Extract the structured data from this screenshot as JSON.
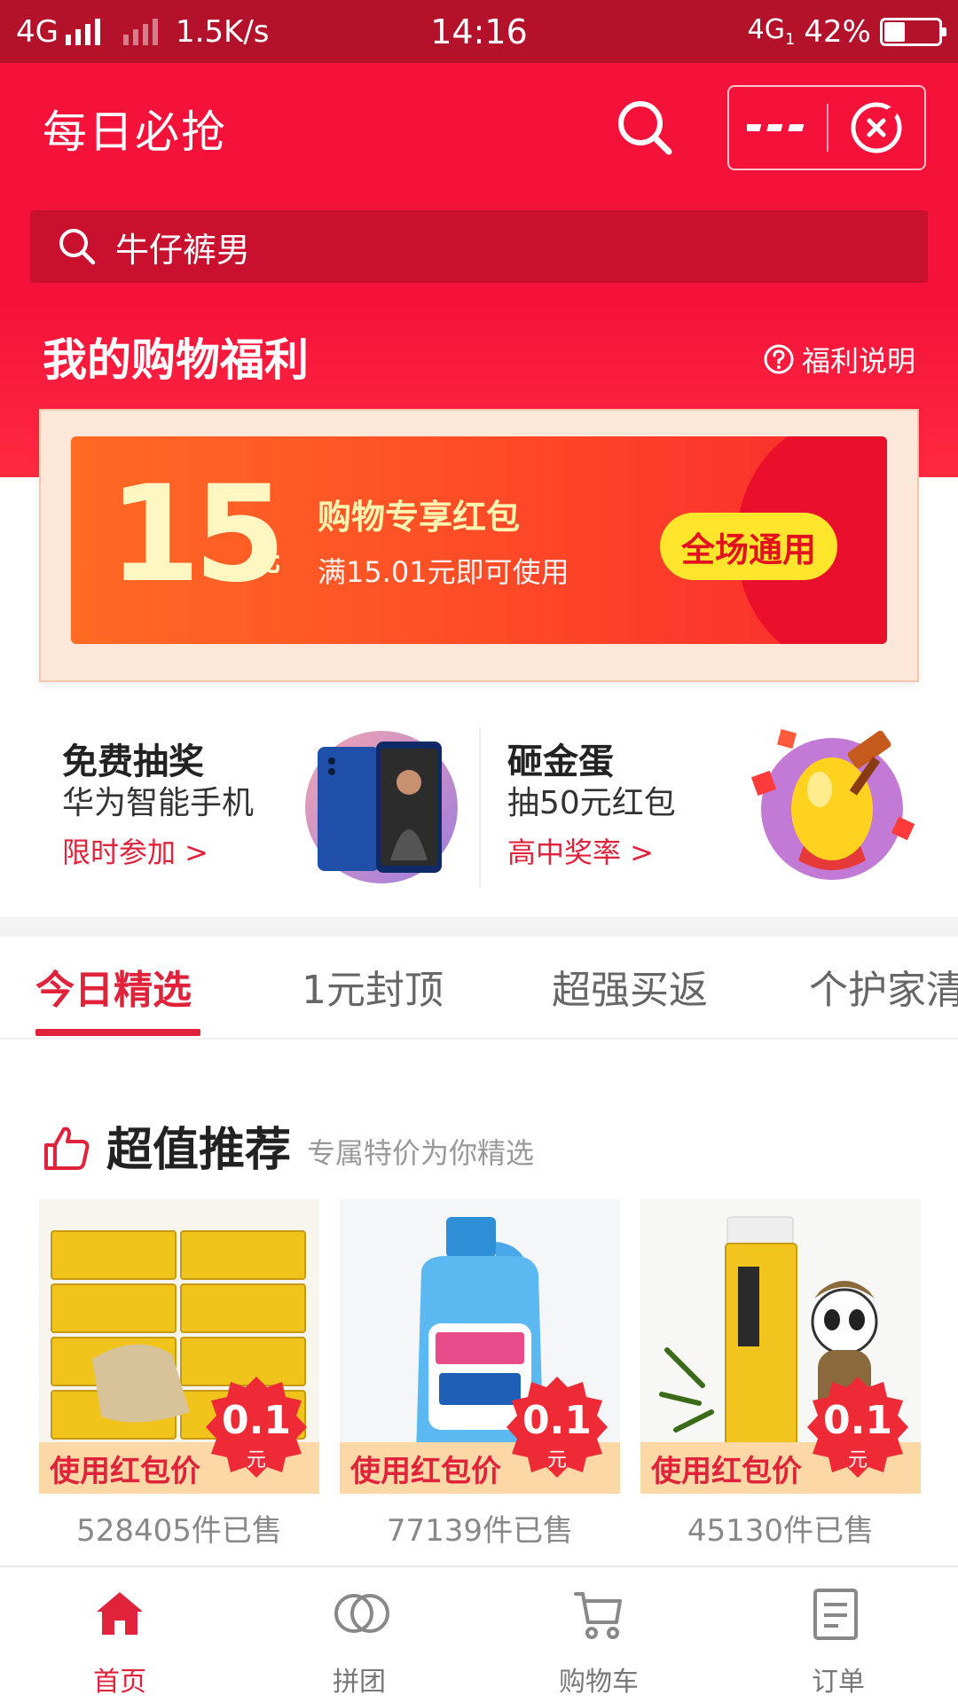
{
  "status_bar": {
    "network": "4G",
    "speed": "1.5K/s",
    "time": "14:16",
    "network_right": "4G",
    "sim": "1",
    "battery": "42%",
    "battery_level": 0.42
  },
  "header": {
    "title": "每日必抢",
    "icons": [
      "search-icon",
      "more-icon",
      "close-icon"
    ],
    "search_query": "牛仔裤男"
  },
  "welfare": {
    "title": "我的购物福利",
    "help_label": "福利说明",
    "coupon": {
      "amount": "15",
      "unit": "元",
      "title": "购物专享红包",
      "condition": "满15.01元即可使用",
      "button": "全场通用"
    }
  },
  "promos": [
    {
      "title": "免费抽奖",
      "subtitle": "华为智能手机",
      "link": "限时参加 >"
    },
    {
      "title": "砸金蛋",
      "subtitle": "抽50元红包",
      "link": "高中奖率 >"
    }
  ],
  "tabs": [
    "今日精选",
    "1元封顶",
    "超强买返",
    "个护家清"
  ],
  "active_tab": 0,
  "section": {
    "title": "超值推荐",
    "subtitle": "专属特价为你精选"
  },
  "products": [
    {
      "tag": "使用红包价",
      "price": "0.1",
      "unit": "元",
      "sold": "528405件已售"
    },
    {
      "tag": "使用红包价",
      "price": "0.1",
      "unit": "元",
      "sold": "77139件已售"
    },
    {
      "tag": "使用红包价",
      "price": "0.1",
      "unit": "元",
      "sold": "45130件已售"
    }
  ],
  "bottom_nav": [
    {
      "label": "首页",
      "icon": "home-icon"
    },
    {
      "label": "拼团",
      "icon": "group-icon"
    },
    {
      "label": "购物车",
      "icon": "cart-icon"
    },
    {
      "label": "订单",
      "icon": "order-icon"
    }
  ],
  "active_nav": 0,
  "colors": {
    "brand_red": "#f5123a",
    "status_bar": "#b4122a",
    "accent": "#e0223b",
    "coupon_button": "#ffe62c",
    "tag_bg": "#fbd8a6"
  }
}
